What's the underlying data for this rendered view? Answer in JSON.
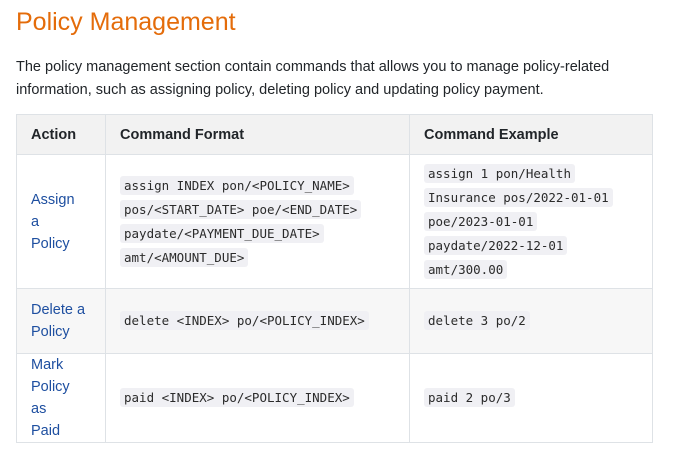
{
  "heading": "Policy Management",
  "intro": "The policy management section contain commands that allows you to manage policy-related information, such as assigning policy, deleting policy and updating policy payment.",
  "table": {
    "headers": [
      "Action",
      "Command Format",
      "Command Example"
    ],
    "rows": [
      {
        "action": "Assign a Policy",
        "format": "assign INDEX pon/<POLICY_NAME> pos/<START_DATE> poe/<END_DATE> paydate/<PAYMENT_DUE_DATE> amt/<AMOUNT_DUE>",
        "example": "assign 1 pon/Health Insurance pos/2022-01-01 poe/2023-01-01 paydate/2022-12-01 amt/300.00"
      },
      {
        "action": "Delete a Policy",
        "format": "delete <INDEX> po/<POLICY_INDEX>",
        "example": "delete 3 po/2"
      },
      {
        "action": "Mark Policy as Paid",
        "format": "paid <INDEX> po/<POLICY_INDEX>",
        "example": "paid 2 po/3"
      }
    ]
  },
  "colors": {
    "heading": "#e46c0a",
    "link": "#1e4fa0"
  }
}
